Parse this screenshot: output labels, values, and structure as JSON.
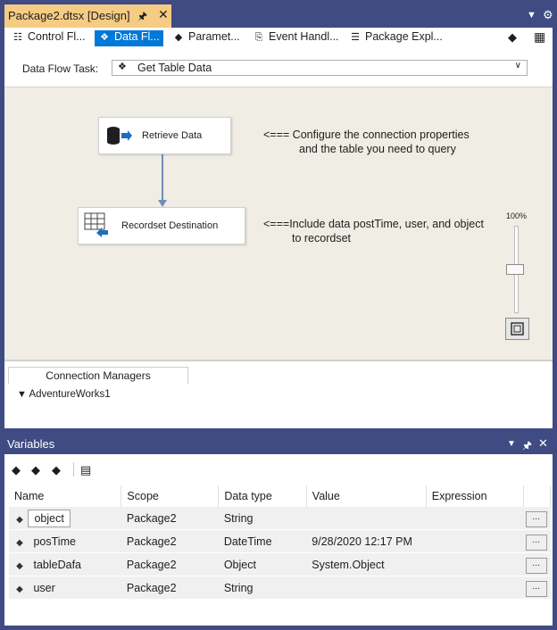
{
  "document_tab": {
    "title": "Package2.dtsx [Design]",
    "pin_icon": "pin-icon",
    "close_icon": "close-icon"
  },
  "designer_tabs": [
    {
      "label": "Control Fl...",
      "icon": "control-flow-icon",
      "active": false
    },
    {
      "label": "Data Fl...",
      "icon": "data-flow-icon",
      "active": true
    },
    {
      "label": "Paramet...",
      "icon": "parameters-icon",
      "active": false
    },
    {
      "label": "Event Handl...",
      "icon": "event-handlers-icon",
      "active": false
    },
    {
      "label": "Package Expl...",
      "icon": "package-explorer-icon",
      "active": false
    }
  ],
  "task_row": {
    "label": "Data Flow Task:",
    "selected": "Get Table Data"
  },
  "canvas": {
    "nodes": [
      {
        "label": "Retrieve Data",
        "icon": "database-source-icon"
      },
      {
        "label": "Recordset Destination",
        "icon": "recordset-destination-icon"
      }
    ],
    "annotations": [
      {
        "lines": [
          "<=== Configure the connection properties",
          "and the table you need to query"
        ]
      },
      {
        "lines": [
          "<===Include data postTime, user, and object",
          "to recordset"
        ]
      }
    ],
    "zoom": "100%"
  },
  "connection_managers": {
    "tab_label": "Connection Managers",
    "items": [
      "AdventureWorks1"
    ]
  },
  "variables": {
    "title": "Variables",
    "columns": [
      "Name",
      "Scope",
      "Data type",
      "Value",
      "Expression"
    ],
    "rows": [
      {
        "name": "object",
        "scope": "Package2",
        "type": "String",
        "value": "",
        "expression": ""
      },
      {
        "name": "posTime",
        "scope": "Package2",
        "type": "DateTime",
        "value": "9/28/2020 12:17 PM",
        "expression": ""
      },
      {
        "name": "tableDafa",
        "scope": "Package2",
        "type": "Object",
        "value": "System.Object",
        "expression": ""
      },
      {
        "name": "user",
        "scope": "Package2",
        "type": "String",
        "value": "",
        "expression": ""
      }
    ],
    "ellipsis_label": "..."
  },
  "colors": {
    "title_bar": "#3f4b82",
    "active_doc_tab": "#f5cc84",
    "canvas": "#efede4",
    "active_subtab": "#0078d7",
    "connector": "#6f8fb8"
  }
}
